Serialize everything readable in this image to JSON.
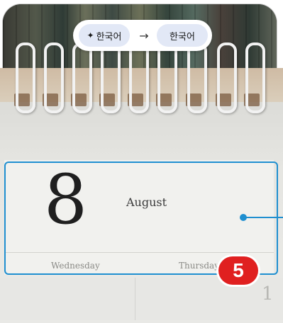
{
  "translate": {
    "source_language": "한국어",
    "target_language": "한국어",
    "sparkle_icon": "✦",
    "arrow_icon": "→"
  },
  "calendar": {
    "day_number": "8",
    "month": "August",
    "weekdays": [
      "Wednesday",
      "Thursday"
    ],
    "lower_page_number": "1"
  },
  "annotation": {
    "step_number": "5",
    "step_color": "#e02020",
    "highlight_color": "#1f8fd0"
  }
}
